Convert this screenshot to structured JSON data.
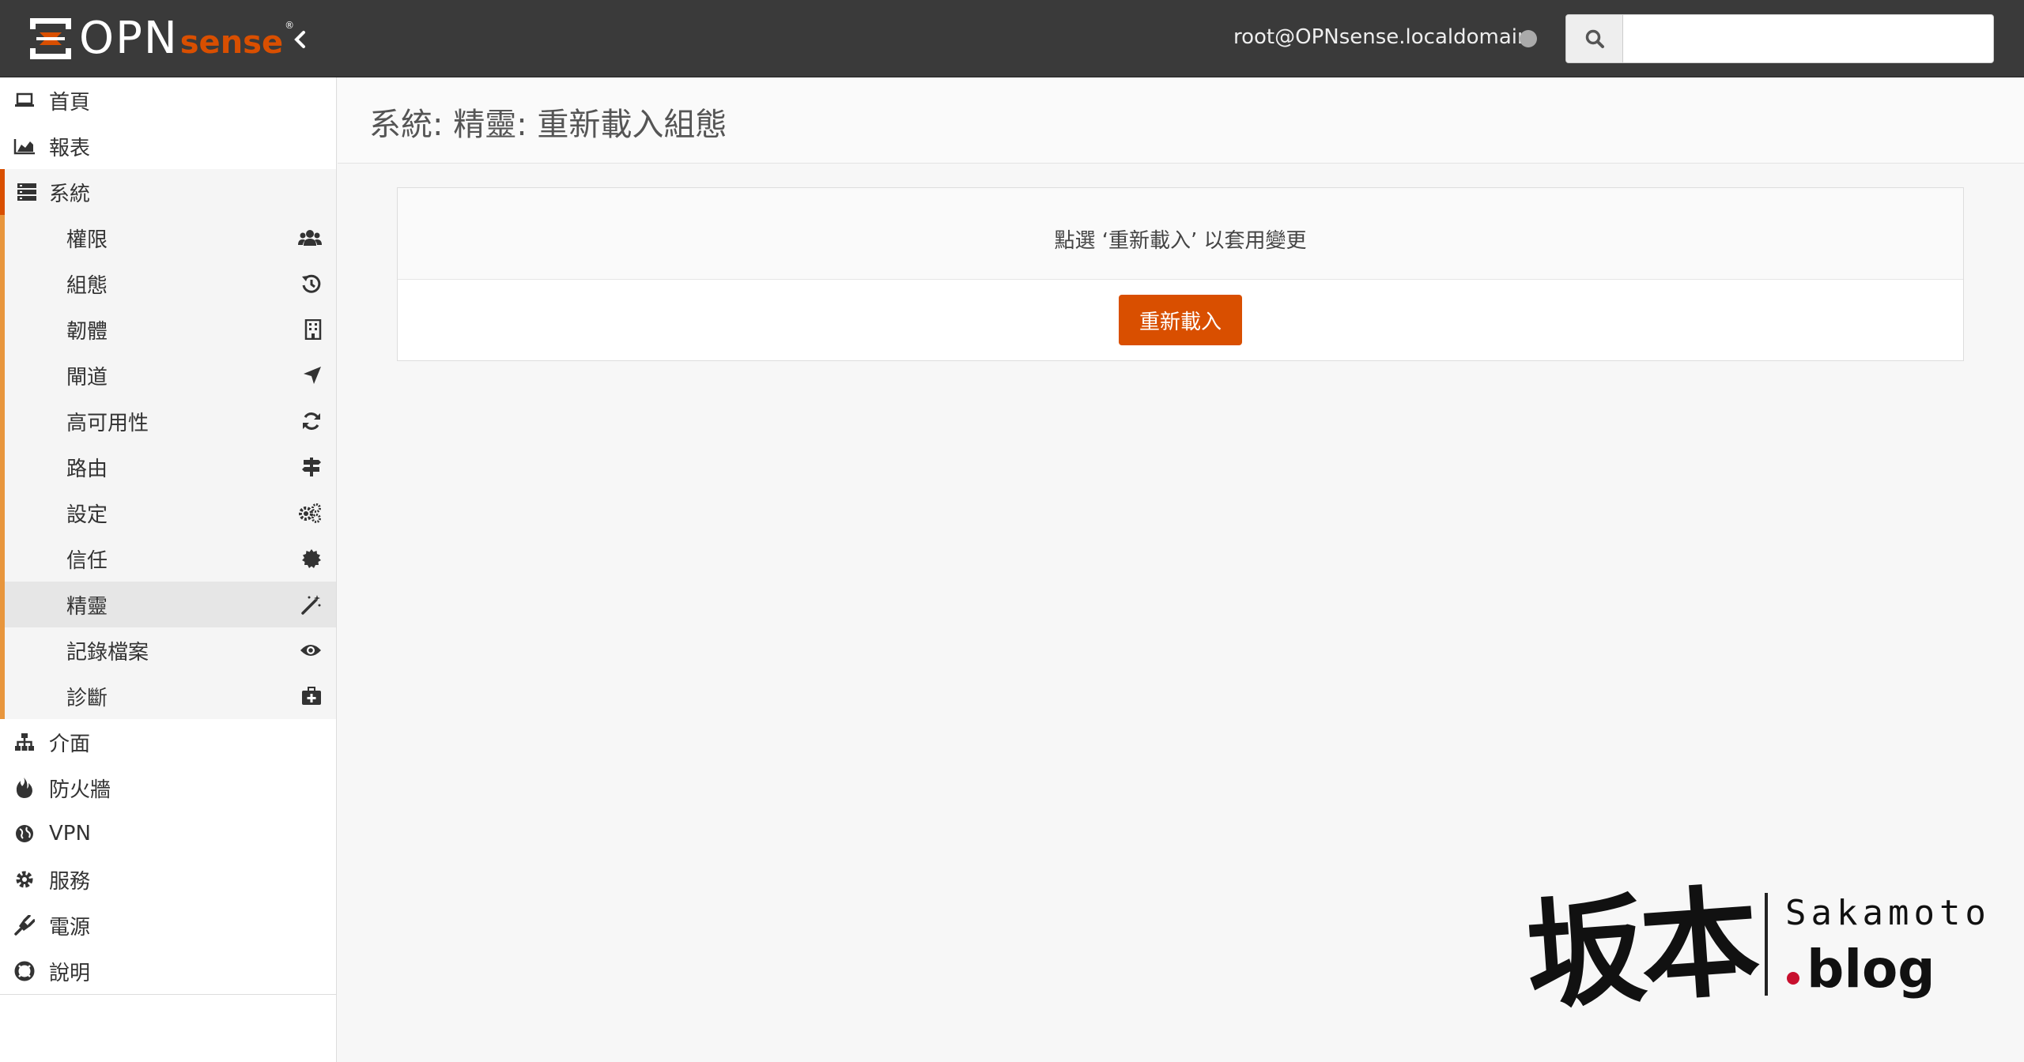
{
  "topbar": {
    "logo_main": "OPN",
    "logo_sub": "sense",
    "logo_reg": "®",
    "user": "root@OPNsense.localdomain",
    "search_placeholder": "",
    "status_color": "#aaaaaa"
  },
  "colors": {
    "accent": "#d94f00",
    "submenu_bar": "#e8963d",
    "topbar_bg": "#3a3a3a"
  },
  "sidebar": {
    "top_items": [
      {
        "label": "首頁",
        "icon": "laptop-icon"
      },
      {
        "label": "報表",
        "icon": "area-chart-icon"
      }
    ],
    "active_section": {
      "label": "系統",
      "icon": "server-icon"
    },
    "sub_items": [
      {
        "label": "權限",
        "icon": "users-icon"
      },
      {
        "label": "組態",
        "icon": "history-icon"
      },
      {
        "label": "韌體",
        "icon": "building-icon"
      },
      {
        "label": "閘道",
        "icon": "location-arrow-icon"
      },
      {
        "label": "高可用性",
        "icon": "refresh-icon"
      },
      {
        "label": "路由",
        "icon": "map-signs-icon"
      },
      {
        "label": "設定",
        "icon": "cogs-icon"
      },
      {
        "label": "信任",
        "icon": "certificate-icon"
      },
      {
        "label": "精靈",
        "icon": "magic-wand-icon"
      },
      {
        "label": "記錄檔案",
        "icon": "eye-icon"
      },
      {
        "label": "診斷",
        "icon": "medkit-icon"
      }
    ],
    "bottom_items": [
      {
        "label": "介面",
        "icon": "sitemap-icon"
      },
      {
        "label": "防火牆",
        "icon": "fire-icon"
      },
      {
        "label": "VPN",
        "icon": "globe-icon"
      },
      {
        "label": "服務",
        "icon": "cog-icon"
      },
      {
        "label": "電源",
        "icon": "plug-icon"
      },
      {
        "label": "說明",
        "icon": "life-ring-icon"
      }
    ]
  },
  "main": {
    "title": "系統: 精靈: 重新載入組態",
    "message": "點選 ‘重新載入’ 以套用變更",
    "button": "重新載入"
  },
  "watermark": {
    "kanji": "坂本",
    "name": "Sakamoto",
    "blog": "blog"
  }
}
